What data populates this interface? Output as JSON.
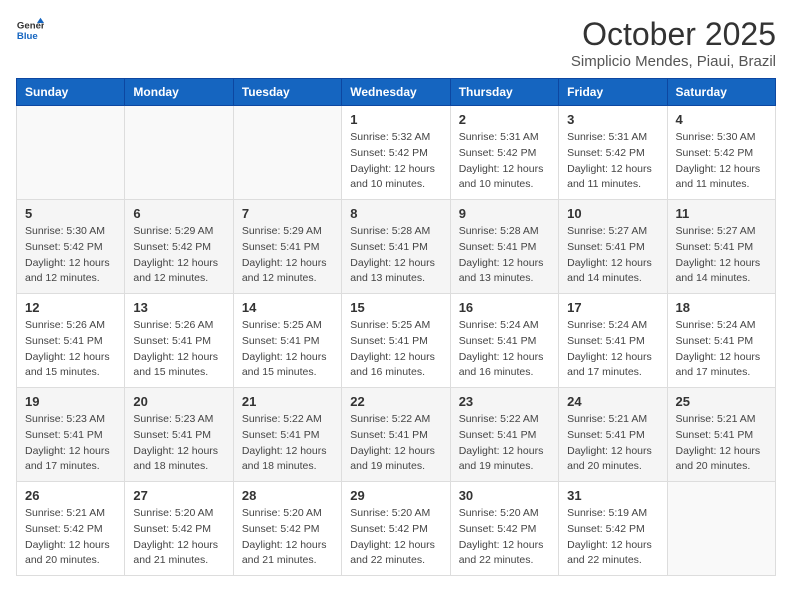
{
  "logo": {
    "line1": "General",
    "line2": "Blue"
  },
  "title": "October 2025",
  "subtitle": "Simplicio Mendes, Piaui, Brazil",
  "headers": [
    "Sunday",
    "Monday",
    "Tuesday",
    "Wednesday",
    "Thursday",
    "Friday",
    "Saturday"
  ],
  "weeks": [
    [
      {
        "day": "",
        "info": ""
      },
      {
        "day": "",
        "info": ""
      },
      {
        "day": "",
        "info": ""
      },
      {
        "day": "1",
        "info": "Sunrise: 5:32 AM\nSunset: 5:42 PM\nDaylight: 12 hours\nand 10 minutes."
      },
      {
        "day": "2",
        "info": "Sunrise: 5:31 AM\nSunset: 5:42 PM\nDaylight: 12 hours\nand 10 minutes."
      },
      {
        "day": "3",
        "info": "Sunrise: 5:31 AM\nSunset: 5:42 PM\nDaylight: 12 hours\nand 11 minutes."
      },
      {
        "day": "4",
        "info": "Sunrise: 5:30 AM\nSunset: 5:42 PM\nDaylight: 12 hours\nand 11 minutes."
      }
    ],
    [
      {
        "day": "5",
        "info": "Sunrise: 5:30 AM\nSunset: 5:42 PM\nDaylight: 12 hours\nand 12 minutes."
      },
      {
        "day": "6",
        "info": "Sunrise: 5:29 AM\nSunset: 5:42 PM\nDaylight: 12 hours\nand 12 minutes."
      },
      {
        "day": "7",
        "info": "Sunrise: 5:29 AM\nSunset: 5:41 PM\nDaylight: 12 hours\nand 12 minutes."
      },
      {
        "day": "8",
        "info": "Sunrise: 5:28 AM\nSunset: 5:41 PM\nDaylight: 12 hours\nand 13 minutes."
      },
      {
        "day": "9",
        "info": "Sunrise: 5:28 AM\nSunset: 5:41 PM\nDaylight: 12 hours\nand 13 minutes."
      },
      {
        "day": "10",
        "info": "Sunrise: 5:27 AM\nSunset: 5:41 PM\nDaylight: 12 hours\nand 14 minutes."
      },
      {
        "day": "11",
        "info": "Sunrise: 5:27 AM\nSunset: 5:41 PM\nDaylight: 12 hours\nand 14 minutes."
      }
    ],
    [
      {
        "day": "12",
        "info": "Sunrise: 5:26 AM\nSunset: 5:41 PM\nDaylight: 12 hours\nand 15 minutes."
      },
      {
        "day": "13",
        "info": "Sunrise: 5:26 AM\nSunset: 5:41 PM\nDaylight: 12 hours\nand 15 minutes."
      },
      {
        "day": "14",
        "info": "Sunrise: 5:25 AM\nSunset: 5:41 PM\nDaylight: 12 hours\nand 15 minutes."
      },
      {
        "day": "15",
        "info": "Sunrise: 5:25 AM\nSunset: 5:41 PM\nDaylight: 12 hours\nand 16 minutes."
      },
      {
        "day": "16",
        "info": "Sunrise: 5:24 AM\nSunset: 5:41 PM\nDaylight: 12 hours\nand 16 minutes."
      },
      {
        "day": "17",
        "info": "Sunrise: 5:24 AM\nSunset: 5:41 PM\nDaylight: 12 hours\nand 17 minutes."
      },
      {
        "day": "18",
        "info": "Sunrise: 5:24 AM\nSunset: 5:41 PM\nDaylight: 12 hours\nand 17 minutes."
      }
    ],
    [
      {
        "day": "19",
        "info": "Sunrise: 5:23 AM\nSunset: 5:41 PM\nDaylight: 12 hours\nand 17 minutes."
      },
      {
        "day": "20",
        "info": "Sunrise: 5:23 AM\nSunset: 5:41 PM\nDaylight: 12 hours\nand 18 minutes."
      },
      {
        "day": "21",
        "info": "Sunrise: 5:22 AM\nSunset: 5:41 PM\nDaylight: 12 hours\nand 18 minutes."
      },
      {
        "day": "22",
        "info": "Sunrise: 5:22 AM\nSunset: 5:41 PM\nDaylight: 12 hours\nand 19 minutes."
      },
      {
        "day": "23",
        "info": "Sunrise: 5:22 AM\nSunset: 5:41 PM\nDaylight: 12 hours\nand 19 minutes."
      },
      {
        "day": "24",
        "info": "Sunrise: 5:21 AM\nSunset: 5:41 PM\nDaylight: 12 hours\nand 20 minutes."
      },
      {
        "day": "25",
        "info": "Sunrise: 5:21 AM\nSunset: 5:41 PM\nDaylight: 12 hours\nand 20 minutes."
      }
    ],
    [
      {
        "day": "26",
        "info": "Sunrise: 5:21 AM\nSunset: 5:42 PM\nDaylight: 12 hours\nand 20 minutes."
      },
      {
        "day": "27",
        "info": "Sunrise: 5:20 AM\nSunset: 5:42 PM\nDaylight: 12 hours\nand 21 minutes."
      },
      {
        "day": "28",
        "info": "Sunrise: 5:20 AM\nSunset: 5:42 PM\nDaylight: 12 hours\nand 21 minutes."
      },
      {
        "day": "29",
        "info": "Sunrise: 5:20 AM\nSunset: 5:42 PM\nDaylight: 12 hours\nand 22 minutes."
      },
      {
        "day": "30",
        "info": "Sunrise: 5:20 AM\nSunset: 5:42 PM\nDaylight: 12 hours\nand 22 minutes."
      },
      {
        "day": "31",
        "info": "Sunrise: 5:19 AM\nSunset: 5:42 PM\nDaylight: 12 hours\nand 22 minutes."
      },
      {
        "day": "",
        "info": ""
      }
    ]
  ]
}
